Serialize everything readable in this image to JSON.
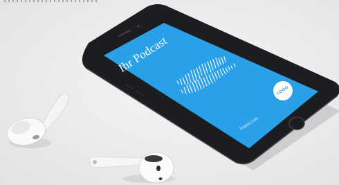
{
  "podcast_title": "Ihr Podcast",
  "brand_text": "brand.com",
  "logo_text": "LOGO",
  "colors": {
    "background": "#ebebeb",
    "phone_body": "#1c1d20",
    "screen": "#29a0e8",
    "wave": "#ffffff",
    "earbud": "#f7f7f7"
  },
  "icons": [
    "phone-device",
    "sound-wave-icon",
    "logo-badge",
    "earbud-left",
    "earbud-right"
  ]
}
